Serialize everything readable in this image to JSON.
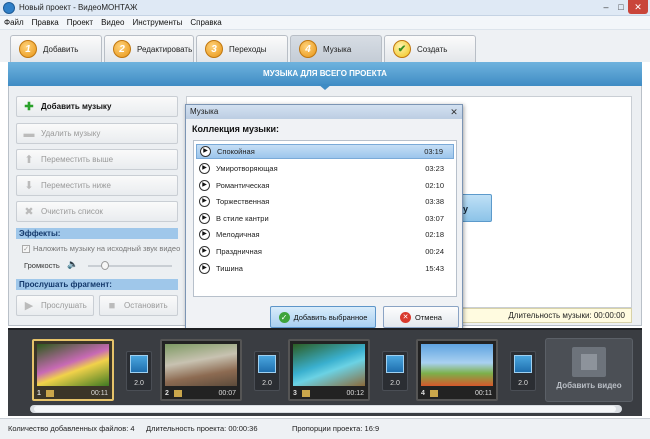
{
  "window": {
    "title": "Новый проект - ВидеоМОНТАЖ",
    "min": "–",
    "max": "□",
    "close": "✕"
  },
  "menu": [
    "Файл",
    "Правка",
    "Проект",
    "Видео",
    "Инструменты",
    "Справка"
  ],
  "tabs": [
    {
      "num": "1",
      "label": "Добавить"
    },
    {
      "num": "2",
      "label": "Редактировать"
    },
    {
      "num": "3",
      "label": "Переходы"
    },
    {
      "num": "4",
      "label": "Музыка"
    },
    {
      "num": "✔",
      "label": "Создать"
    }
  ],
  "banner": "МУЗЫКА ДЛЯ ВСЕГО ПРОЕКТА",
  "sidebar": {
    "add_music": "Добавить музыку",
    "delete_music": "Удалить музыку",
    "move_up": "Переместить выше",
    "move_down": "Переместить ниже",
    "clear_list": "Очистить список",
    "effects_header": "Эффекты:",
    "overlay_checkbox": "Наложить музыку на исходный звук видео",
    "volume_label": "Громкость",
    "listen_header": "Прослушать фрагмент:",
    "listen_btn": "Прослушать",
    "stop_btn": "Остановить"
  },
  "music_length": "Длительность музыки: 00:00:00",
  "dialog": {
    "title": "Музыка",
    "heading": "Коллекция музыки:",
    "tracks": [
      {
        "name": "Спокойная",
        "dur": "03:19"
      },
      {
        "name": "Умиротворяющая",
        "dur": "03:23"
      },
      {
        "name": "Романтическая",
        "dur": "02:10"
      },
      {
        "name": "Торжественная",
        "dur": "03:38"
      },
      {
        "name": "В стиле кантри",
        "dur": "03:07"
      },
      {
        "name": "Мелодичная",
        "dur": "02:18"
      },
      {
        "name": "Праздничная",
        "dur": "00:24"
      },
      {
        "name": "Тишина",
        "dur": "15:43"
      }
    ],
    "add_selected": "Добавить выбранное",
    "cancel": "Отмена"
  },
  "timeline": {
    "clips": [
      {
        "num": "1",
        "dur": "00:11"
      },
      {
        "num": "2",
        "dur": "00:07"
      },
      {
        "num": "3",
        "dur": "00:12"
      },
      {
        "num": "4",
        "dur": "00:11"
      }
    ],
    "transitions": [
      "2.0",
      "2.0",
      "2.0",
      "2.0"
    ],
    "add_video": "Добавить видео"
  },
  "status": {
    "files": "Количество добавленных файлов: 4",
    "duration": "Длительность проекта: 00:00:36",
    "ratio": "Пропорции проекта: 16:9"
  },
  "colors": {
    "accent": "#3f8cc4",
    "tab_badge": "#e79414",
    "selection": "#9cc5ec"
  }
}
